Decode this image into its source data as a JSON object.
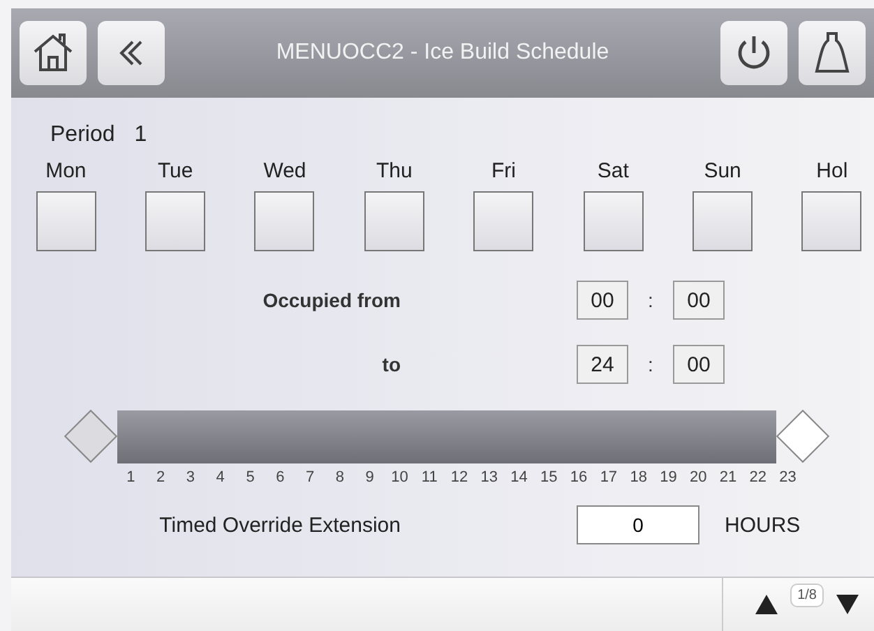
{
  "header": {
    "title": "MENUOCC2 - Ice Build Schedule"
  },
  "period": {
    "label": "Period",
    "value": "1"
  },
  "days": [
    {
      "label": "Mon",
      "checked": false
    },
    {
      "label": "Tue",
      "checked": false
    },
    {
      "label": "Wed",
      "checked": false
    },
    {
      "label": "Thu",
      "checked": false
    },
    {
      "label": "Fri",
      "checked": false
    },
    {
      "label": "Sat",
      "checked": false
    },
    {
      "label": "Sun",
      "checked": false
    },
    {
      "label": "Hol",
      "checked": false
    }
  ],
  "times": [
    {
      "label": "Occupied from",
      "hours": "00",
      "separator": ":",
      "minutes": "00"
    },
    {
      "label": "to",
      "hours": "24",
      "separator": ":",
      "minutes": "00"
    }
  ],
  "range": {
    "start": {
      "level": 0
    },
    "end": {
      "level": 1
    },
    "ticks": [
      "1",
      "2",
      "3",
      "4",
      "5",
      "6",
      "7",
      "8",
      "9",
      "10",
      "11",
      "12",
      "13",
      "14",
      "15",
      "16",
      "17",
      "18",
      "19",
      "20",
      "21",
      "22",
      "23"
    ]
  },
  "override": {
    "label": "Timed Override Extension",
    "value": "0",
    "unit": "HOURS"
  },
  "footer": {
    "page": "1/8"
  }
}
